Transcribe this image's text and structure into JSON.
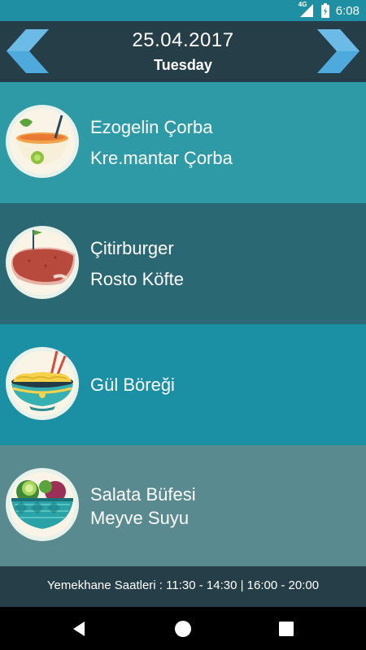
{
  "status_bar": {
    "time": "6:08",
    "network": "4G"
  },
  "header": {
    "date": "25.04.2017",
    "day": "Tuesday"
  },
  "meals": [
    {
      "icon": "soup-bowl-icon",
      "items": [
        "Ezogelin Çorba",
        "Kre.mantar Çorba"
      ]
    },
    {
      "icon": "meat-steak-icon",
      "items": [
        "Çitirburger",
        "Rosto Köfte"
      ]
    },
    {
      "icon": "noodle-bowl-icon",
      "items": [
        "Gül Böreği"
      ]
    },
    {
      "icon": "salad-bowl-icon",
      "items": [
        "Salata Büfesi",
        "Meyve Suyu"
      ]
    }
  ],
  "footer": {
    "hours": "Yemekhane Saatleri : 11:30 - 14:30 | 16:00 - 20:00"
  },
  "colors": {
    "header": "#263e47",
    "accent_arrow": "#4ea9dd",
    "status_bar": "#1f8fa3"
  }
}
